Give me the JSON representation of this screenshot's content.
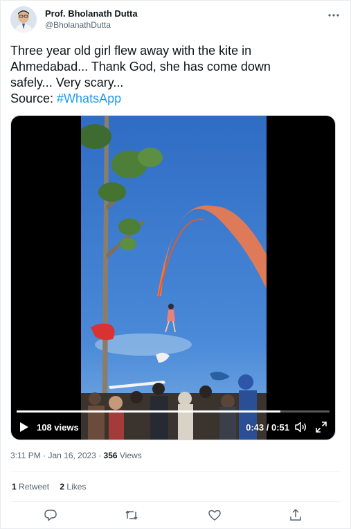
{
  "user": {
    "name": "Prof. Bholanath Dutta",
    "handle": "@BholanathDutta"
  },
  "tweet": {
    "lines": [
      "Three year old girl flew away with the kite in",
      "Ahmedabad... Thank God, she has come down",
      "safely... Very scary...",
      "Source: "
    ],
    "hashtag": "#WhatsApp"
  },
  "video": {
    "views": "108 views",
    "time": "0:43 / 0:51",
    "progress": 0.843
  },
  "meta": {
    "time": "3:11 PM · Jan 16, 2023 · ",
    "views_count": "356",
    "views_label": " Views"
  },
  "stats": {
    "retweets_count": "1",
    "retweets_label": " Retweet",
    "likes_count": "2",
    "likes_label": " Likes"
  },
  "icons": {
    "more": "more-horizontal-icon",
    "play": "play-icon",
    "volume": "volume-icon",
    "fullscreen": "fullscreen-icon",
    "reply": "reply-icon",
    "retweet": "retweet-icon",
    "like": "heart-icon",
    "share": "share-icon"
  },
  "colors": {
    "accent": "#1d9bf0",
    "text": "#0f1419",
    "muted": "#536471"
  }
}
